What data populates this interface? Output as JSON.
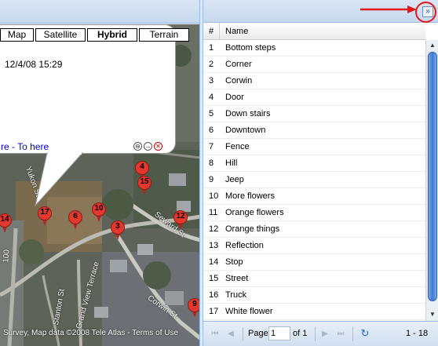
{
  "map": {
    "map_types": [
      {
        "label": "Map",
        "active": false
      },
      {
        "label": "Satellite",
        "active": false
      },
      {
        "label": "Hybrid",
        "active": true
      },
      {
        "label": "Terrain",
        "active": false
      }
    ],
    "info_window": {
      "date": "12/4/08 15:29",
      "directions": "re - To here"
    },
    "markers": [
      "4",
      "15",
      "17",
      "6",
      "10",
      "3",
      "12",
      "14",
      "9"
    ],
    "streets": [
      "Seward St",
      "Yukon St",
      "Grand View Terrace",
      "Corwin St",
      "Stanton St",
      "100"
    ],
    "copyright": "Survey, Map data ©2008 Tele Atlas - Terms of Use",
    "colors": {
      "marker": "#e2382e",
      "link": "#0000cc"
    }
  },
  "grid": {
    "columns": [
      "#",
      "Name"
    ],
    "rows": [
      {
        "num": "1",
        "name": "Bottom steps"
      },
      {
        "num": "2",
        "name": "Corner"
      },
      {
        "num": "3",
        "name": "Corwin"
      },
      {
        "num": "4",
        "name": "Door"
      },
      {
        "num": "5",
        "name": "Down stairs"
      },
      {
        "num": "6",
        "name": "Downtown"
      },
      {
        "num": "7",
        "name": "Fence"
      },
      {
        "num": "8",
        "name": "Hill"
      },
      {
        "num": "9",
        "name": "Jeep"
      },
      {
        "num": "10",
        "name": "More flowers"
      },
      {
        "num": "11",
        "name": "Orange flowers"
      },
      {
        "num": "12",
        "name": "Orange things"
      },
      {
        "num": "13",
        "name": "Reflection"
      },
      {
        "num": "14",
        "name": "Stop"
      },
      {
        "num": "15",
        "name": "Street"
      },
      {
        "num": "16",
        "name": "Truck"
      },
      {
        "num": "17",
        "name": "White flower"
      }
    ],
    "collapse_icon": "double-chevron-right-icon",
    "paging": {
      "page_label": "Page",
      "page_value": "1",
      "of_label": "of 1",
      "range": "1 - 18"
    },
    "colors": {
      "header": "#c7d8ee",
      "annotation": "#e2191a",
      "scroll_thumb": "#3f79d3"
    }
  }
}
